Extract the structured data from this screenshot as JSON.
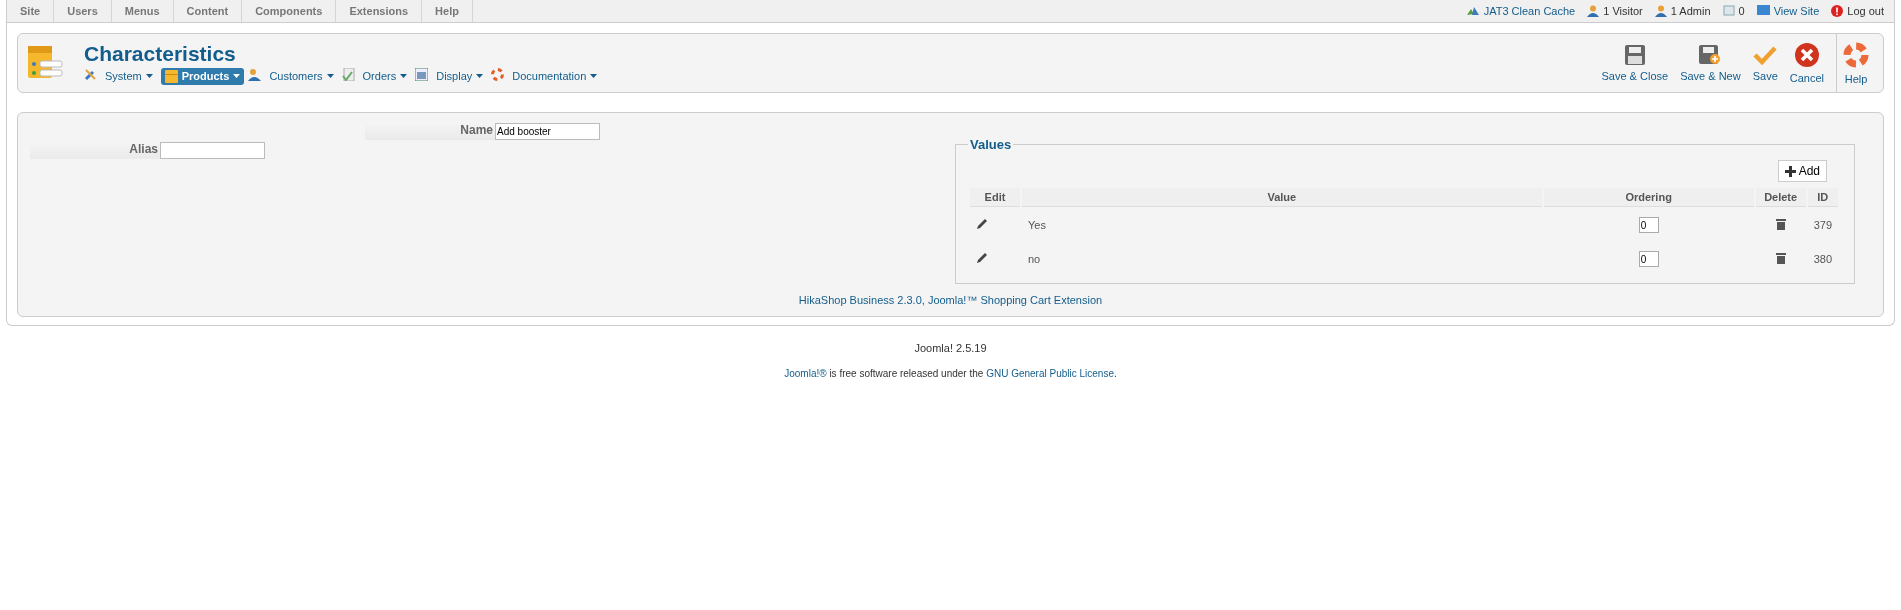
{
  "top_menu": [
    {
      "label": "Site"
    },
    {
      "label": "Users"
    },
    {
      "label": "Menus"
    },
    {
      "label": "Content"
    },
    {
      "label": "Components"
    },
    {
      "label": "Extensions"
    },
    {
      "label": "Help"
    }
  ],
  "status": [
    {
      "kind": "cache",
      "label": "JAT3 Clean Cache"
    },
    {
      "kind": "visitor",
      "label": "1 Visitor"
    },
    {
      "kind": "admin",
      "label": "1 Admin"
    },
    {
      "kind": "messages",
      "label": "0"
    },
    {
      "kind": "view",
      "label": "View Site"
    },
    {
      "kind": "logout",
      "label": "Log out"
    }
  ],
  "title": "Characteristics",
  "submenu": [
    {
      "kind": "system",
      "label": "System",
      "selected": false
    },
    {
      "kind": "products",
      "label": "Products",
      "selected": true
    },
    {
      "kind": "customers",
      "label": "Customers",
      "selected": false
    },
    {
      "kind": "orders",
      "label": "Orders",
      "selected": false
    },
    {
      "kind": "display",
      "label": "Display",
      "selected": false
    },
    {
      "kind": "documentation",
      "label": "Documentation",
      "selected": false
    }
  ],
  "toolbar": [
    {
      "kind": "save-close",
      "label": "Save & Close"
    },
    {
      "kind": "save-new",
      "label": "Save & New"
    },
    {
      "kind": "save",
      "label": "Save"
    },
    {
      "kind": "cancel",
      "label": "Cancel"
    },
    {
      "kind": "help",
      "label": "Help"
    }
  ],
  "form": {
    "name": {
      "label": "Name",
      "value": "Add booster"
    },
    "alias": {
      "label": "Alias"
    }
  },
  "values": {
    "legend": "Values",
    "add_button": "Add",
    "columns": [
      "Edit",
      "Value",
      "Ordering",
      "Delete",
      "ID"
    ],
    "rows": [
      {
        "value": "Yes",
        "ordering": "0",
        "id": "379"
      },
      {
        "value": "no",
        "ordering": "0",
        "id": "380"
      }
    ]
  },
  "credit": "HikaShop Business 2.3.0, Joomla!™ Shopping Cart Extension",
  "version": "Joomla! 2.5.19",
  "license": {
    "link1": "Joomla!®",
    "text": " is free software released under the ",
    "link2": "GNU General Public License",
    "end": "."
  }
}
